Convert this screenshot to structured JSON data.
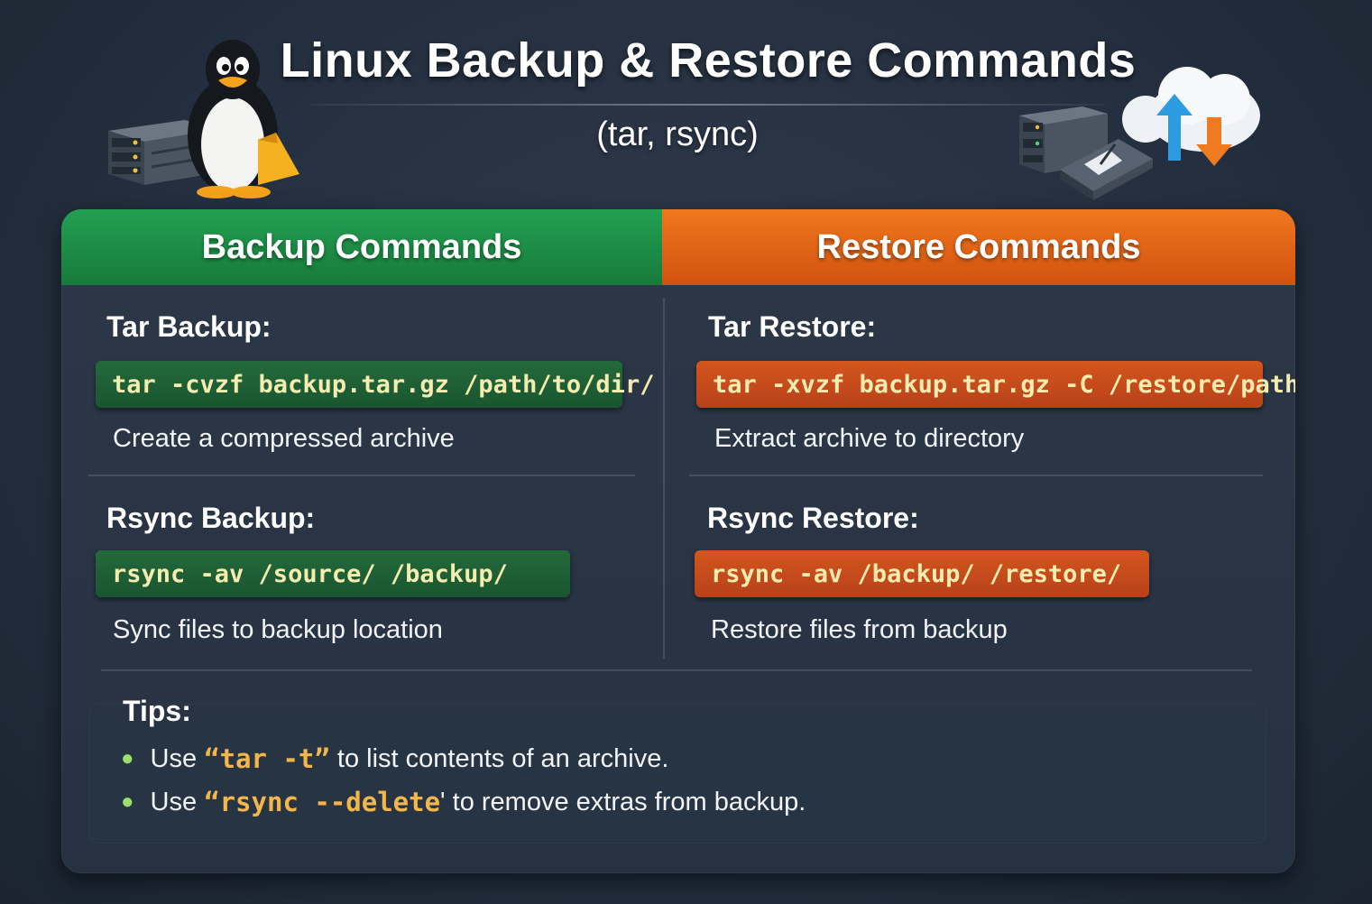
{
  "header": {
    "title": "Linux Backup & Restore Commands",
    "subtitle": "(tar, rsync)"
  },
  "icons": {
    "left": [
      "penguin-icon",
      "server-icon"
    ],
    "right": [
      "server-icon",
      "disk-icon",
      "cloud-sync-icon"
    ]
  },
  "backup": {
    "heading": "Backup Commands",
    "tar": {
      "title": "Tar Backup:",
      "command": "tar -cvzf backup.tar.gz /path/to/dir/",
      "description": "Create a compressed archive"
    },
    "rsync": {
      "title": "Rsync Backup:",
      "command": "rsync -av /source/ /backup/",
      "description": "Sync files to backup location"
    }
  },
  "restore": {
    "heading": "Restore Commands",
    "tar": {
      "title": "Tar Restore:",
      "command": "tar -xvzf backup.tar.gz -C /restore/path/",
      "description": "Extract archive to directory"
    },
    "rsync": {
      "title": "Rsync Restore:",
      "command": "rsync -av /backup/ /restore/",
      "description": "Restore files from backup"
    }
  },
  "tips": {
    "title": "Tips:",
    "items": [
      {
        "prefix": "Use ",
        "code": "“tar -t”",
        "suffix": " to list contents of an archive."
      },
      {
        "prefix": "Use ",
        "code": "“rsync --delete",
        "suffix": "' to remove extras from backup."
      }
    ]
  },
  "colors": {
    "backup_accent": "#1f8f48",
    "restore_accent": "#e5661a",
    "command_text": "#f5ecb0",
    "tip_highlight": "#f2b64a",
    "bullet": "#9be06a"
  }
}
